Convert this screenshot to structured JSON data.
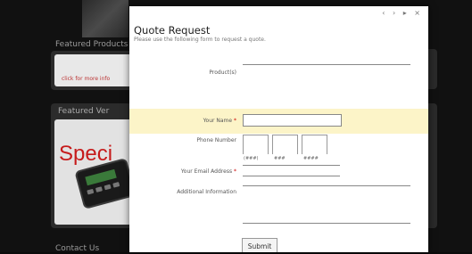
{
  "background": {
    "heading_products": "Featured Products",
    "link_more": "click for more info",
    "heading_featured": "Featured Ver",
    "special_text": "Speci",
    "heading_contact": "Contact Us"
  },
  "modal": {
    "nav_glyphs": "‹ › ▸ ×",
    "title": "Quote Request",
    "subtitle": "Please use the following form to request a quote.",
    "fields": {
      "products_label": "Product(s)",
      "name_label": "Your Name",
      "name_required": "*",
      "phone_label": "Phone Number",
      "phone_caps": [
        "(###)",
        "###",
        "####"
      ],
      "email_label": "Your Email Address",
      "email_required": "*",
      "info_label": "Additional Information"
    },
    "submit_label": "Submit"
  }
}
